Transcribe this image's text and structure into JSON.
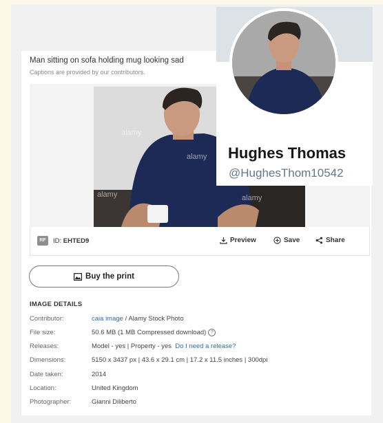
{
  "caption": {
    "title": "Man sitting on sofa holding mug looking sad",
    "subtitle": "Captions are provided by our contributors."
  },
  "image": {
    "watermark": "alamy",
    "badge": "RF",
    "id_label": "ID:",
    "id_value": "EHTED9"
  },
  "actions": {
    "preview": "Preview",
    "save": "Save",
    "share": "Share",
    "buy_print": "Buy the print"
  },
  "details": {
    "heading": "IMAGE DETAILS",
    "contributor_label": "Contributor:",
    "contributor_link": "caia image",
    "contributor_rest": " / Alamy Stock Photo",
    "filesize_label": "File size:",
    "filesize_value": "50.6 MB (1 MB Compressed download)",
    "releases_label": "Releases:",
    "releases_value": "Model - yes | Property - yes",
    "releases_link": "Do I need a release?",
    "dimensions_label": "Dimensions:",
    "dimensions_value": "5150 x 3437 px | 43.6 x 29.1 cm | 17.2 x 11.5 inches | 300dpi",
    "date_label": "Date taken:",
    "date_value": "2014",
    "location_label": "Location:",
    "location_value": "United Kingdom",
    "photographer_label": "Photographer:",
    "photographer_value": "Gianni Diliberto"
  },
  "profile": {
    "name": "Hughes Thomas",
    "handle": "@HughesThom10542"
  },
  "colors": {
    "link": "#2b6cb0",
    "shirt": "#1d2a55",
    "page_bg": "#fdf9e8"
  }
}
